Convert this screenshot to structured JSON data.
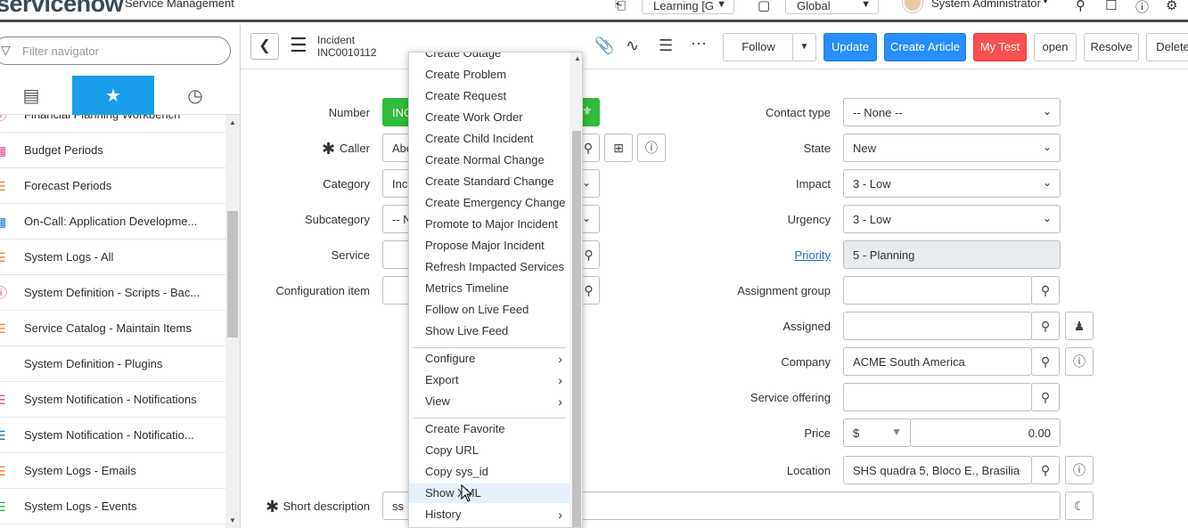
{
  "banner": {
    "logo": "servicenow",
    "product": "Service Management",
    "update_set": "Learning [G",
    "scope": "Global",
    "user": "System Administrator"
  },
  "navigator": {
    "filter_placeholder": "Filter navigator",
    "items": [
      {
        "label": "Financial Planning Workbench",
        "icon": "info-icon",
        "color": "#e0428a"
      },
      {
        "label": "Budget Periods",
        "icon": "grid-icon",
        "color": "#e0428a"
      },
      {
        "label": "Forecast Periods",
        "icon": "list-icon",
        "color": "#f07a2a"
      },
      {
        "label": "On-Call: Application Developme...",
        "icon": "calendar-icon",
        "color": "#1a6fd1"
      },
      {
        "label": "System Logs - All",
        "icon": "list-icon",
        "color": "#f07a2a"
      },
      {
        "label": "System Definition - Scripts - Bac...",
        "icon": "info-icon",
        "color": "#e0428a"
      },
      {
        "label": "Service Catalog - Maintain Items",
        "icon": "list-icon",
        "color": "#f07a2a"
      },
      {
        "label": "System Definition - Plugins",
        "icon": "",
        "color": ""
      },
      {
        "label": "System Notification - Notifications",
        "icon": "list-icon",
        "color": "#e0428a"
      },
      {
        "label": "System Notification - Notificatio...",
        "icon": "list-icon",
        "color": "#1a6fd1"
      },
      {
        "label": "System Logs - Emails",
        "icon": "list-icon",
        "color": "#f07a2a"
      },
      {
        "label": "System Logs - Events",
        "icon": "list-icon",
        "color": "#2eaa4a"
      }
    ]
  },
  "header": {
    "record_type": "Incident",
    "record_number": "INC0010112",
    "buttons": {
      "follow": "Follow",
      "update": "Update",
      "create_article": "Create Article",
      "my_test": "My Test",
      "open": "open",
      "resolve": "Resolve",
      "delete": "Delete"
    }
  },
  "form": {
    "left": {
      "number_label": "Number",
      "number_value": "INC",
      "caller_label": "Caller",
      "caller_value": "Abe",
      "category_label": "Category",
      "category_value": "Inc",
      "subcategory_label": "Subcategory",
      "subcategory_value": "-- N",
      "service_label": "Service",
      "service_value": "",
      "ci_label": "Configuration item",
      "ci_value": "",
      "short_desc_label": "Short description",
      "short_desc_value": "ss"
    },
    "right": {
      "contact_type_label": "Contact type",
      "contact_type_value": "-- None --",
      "state_label": "State",
      "state_value": "New",
      "impact_label": "Impact",
      "impact_value": "3 - Low",
      "urgency_label": "Urgency",
      "urgency_value": "3 - Low",
      "priority_label": "Priority",
      "priority_value": "5 - Planning",
      "assignment_group_label": "Assignment group",
      "assignment_group_value": "",
      "assigned_label": "Assigned",
      "assigned_value": "",
      "company_label": "Company",
      "company_value": "ACME South America",
      "service_offering_label": "Service offering",
      "service_offering_value": "",
      "price_label": "Price",
      "price_currency": "$",
      "price_value": "0.00",
      "location_label": "Location",
      "location_value": "SHS quadra 5, Bloco E., Brasilia"
    }
  },
  "context_menu": {
    "items": [
      {
        "label": "Create Outage"
      },
      {
        "label": "Create Problem"
      },
      {
        "label": "Create Request"
      },
      {
        "label": "Create Work Order"
      },
      {
        "label": "Create Child Incident"
      },
      {
        "label": "Create Normal Change"
      },
      {
        "label": "Create Standard Change"
      },
      {
        "label": "Create Emergency Change"
      },
      {
        "label": "Promote to Major Incident"
      },
      {
        "label": "Propose Major Incident"
      },
      {
        "label": "Refresh Impacted Services"
      },
      {
        "label": "Metrics Timeline"
      },
      {
        "label": "Follow on Live Feed"
      },
      {
        "label": "Show Live Feed"
      },
      {
        "label": "Configure",
        "submenu": true
      },
      {
        "label": "Export",
        "submenu": true
      },
      {
        "label": "View",
        "submenu": true
      },
      {
        "label": "Create Favorite"
      },
      {
        "label": "Copy URL"
      },
      {
        "label": "Copy sys_id"
      },
      {
        "label": "Show XML",
        "highlighted": true
      },
      {
        "label": "History",
        "submenu": true
      }
    ]
  },
  "colors": {
    "accent_blue": "#278efc",
    "danger_red": "#f95050",
    "nav_active": "#1a9eea",
    "number_green": "#2ebd3a"
  }
}
